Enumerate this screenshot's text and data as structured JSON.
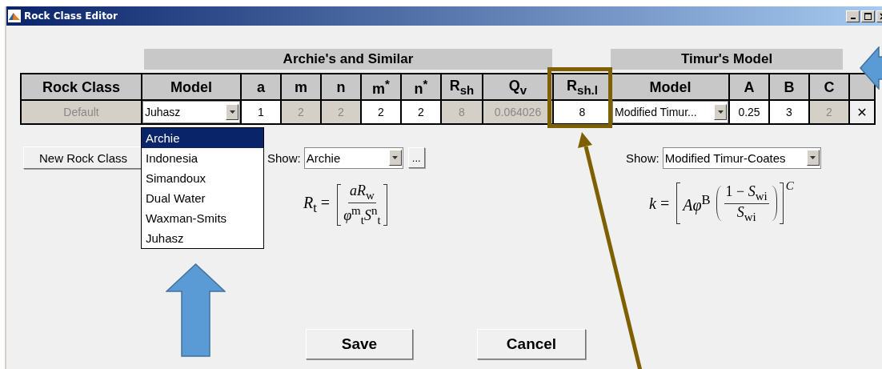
{
  "window": {
    "title": "Rock Class Editor"
  },
  "groups": [
    {
      "label": "Archie's and Similar"
    },
    {
      "label": "Timur's Model"
    }
  ],
  "table": {
    "columns": [
      {
        "label": "Rock Class",
        "highlighted": false
      },
      {
        "label": "Model",
        "highlighted": false
      },
      {
        "label": "a",
        "highlighted": false
      },
      {
        "label": "m",
        "highlighted": false
      },
      {
        "label": "n",
        "highlighted": false
      },
      {
        "label": "m$^{*}$",
        "highlighted": false
      },
      {
        "label": "n$^{*}$",
        "highlighted": false
      },
      {
        "label": "R$_{sh}$",
        "highlighted": false
      },
      {
        "label": "Q$_{v}$",
        "highlighted": false
      },
      {
        "label": "R$_{sh.l}$",
        "highlighted": true
      },
      {
        "label": "Model",
        "highlighted": false
      },
      {
        "label": "A",
        "highlighted": false
      },
      {
        "label": "B",
        "highlighted": false
      },
      {
        "label": "C",
        "highlighted": false
      },
      {
        "highlighted": false
      }
    ],
    "rows": [
      {
        "cells": [
          {
            "kind": "label",
            "value": "Default",
            "disabled": true
          },
          {
            "kind": "select",
            "value": "Juhasz"
          },
          {
            "kind": "input",
            "value": "1",
            "disabled": false
          },
          {
            "kind": "input",
            "value": "2",
            "disabled": true
          },
          {
            "kind": "input",
            "value": "2",
            "disabled": true
          },
          {
            "kind": "input",
            "value": "2",
            "disabled": false
          },
          {
            "kind": "input",
            "value": "2",
            "disabled": false
          },
          {
            "kind": "input",
            "value": "8",
            "disabled": true
          },
          {
            "kind": "input",
            "value": "0.064026",
            "disabled": true
          },
          {
            "kind": "input",
            "value": "8",
            "disabled": false
          },
          {
            "kind": "select",
            "value": "Modified Timur..."
          },
          {
            "kind": "input",
            "value": "0.25",
            "disabled": false
          },
          {
            "kind": "input",
            "value": "3",
            "disabled": false
          },
          {
            "kind": "input",
            "value": "2",
            "disabled": true
          },
          {
            "kind": "delete",
            "value": "✕"
          }
        ]
      }
    ]
  },
  "model_dropdown": {
    "options": [
      {
        "label": "Archie",
        "selected": true
      },
      {
        "label": "Indonesia",
        "selected": false
      },
      {
        "label": "Simandoux",
        "selected": false
      },
      {
        "label": "Dual Water",
        "selected": false
      },
      {
        "label": "Waxman-Smits",
        "selected": false
      },
      {
        "label": "Juhasz",
        "selected": false
      }
    ]
  },
  "new_rock_class_button": "New Rock Class",
  "archie_panel": {
    "show_label": "Show:",
    "show_value": "Archie",
    "more_button": "...",
    "formula": {
      "lhs": "*R*$_{t}$ =",
      "numerator": "*aR*$_{w}$",
      "denominator": "*φ*$^{m}$$_{t}$*S*$^{n}$$_{t}$"
    }
  },
  "timur_panel": {
    "show_label": "Show:",
    "show_value": "Modified Timur-Coates",
    "formula": {
      "lhs": "*k* =",
      "factor": "*Aφ*$^{B}$",
      "numerator": "1 − *S*$_{wi}$",
      "denominator": "*S*$_{wi}$",
      "exponent": "C"
    }
  },
  "buttons": [
    "Save",
    "Cancel"
  ]
}
